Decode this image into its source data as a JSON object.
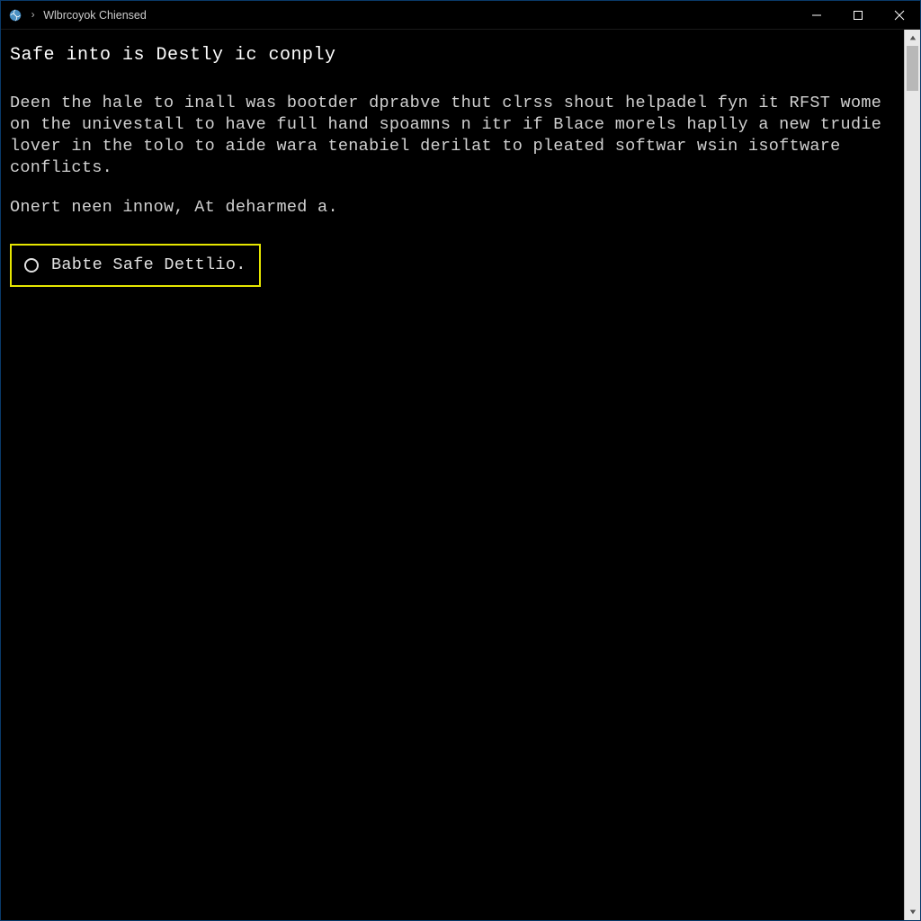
{
  "window": {
    "title": "Wlbrcoyok Chiensed"
  },
  "content": {
    "heading": "Safe into is Destly ic conply",
    "paragraph1": "Deen the hale to inall was bootder dprabve thut clrss shout helpadel fyn it RFST wome on the univestall to have full hand spoamns n itr if  Blace morels haplly a new trudie lover in the tolo to aide wara tenabiel derilat to pleated softwar wsin isoftware conflicts.",
    "paragraph2": "Onert neen innow, At deharmed a."
  },
  "option": {
    "label": "Babte Safe Dettlio."
  }
}
